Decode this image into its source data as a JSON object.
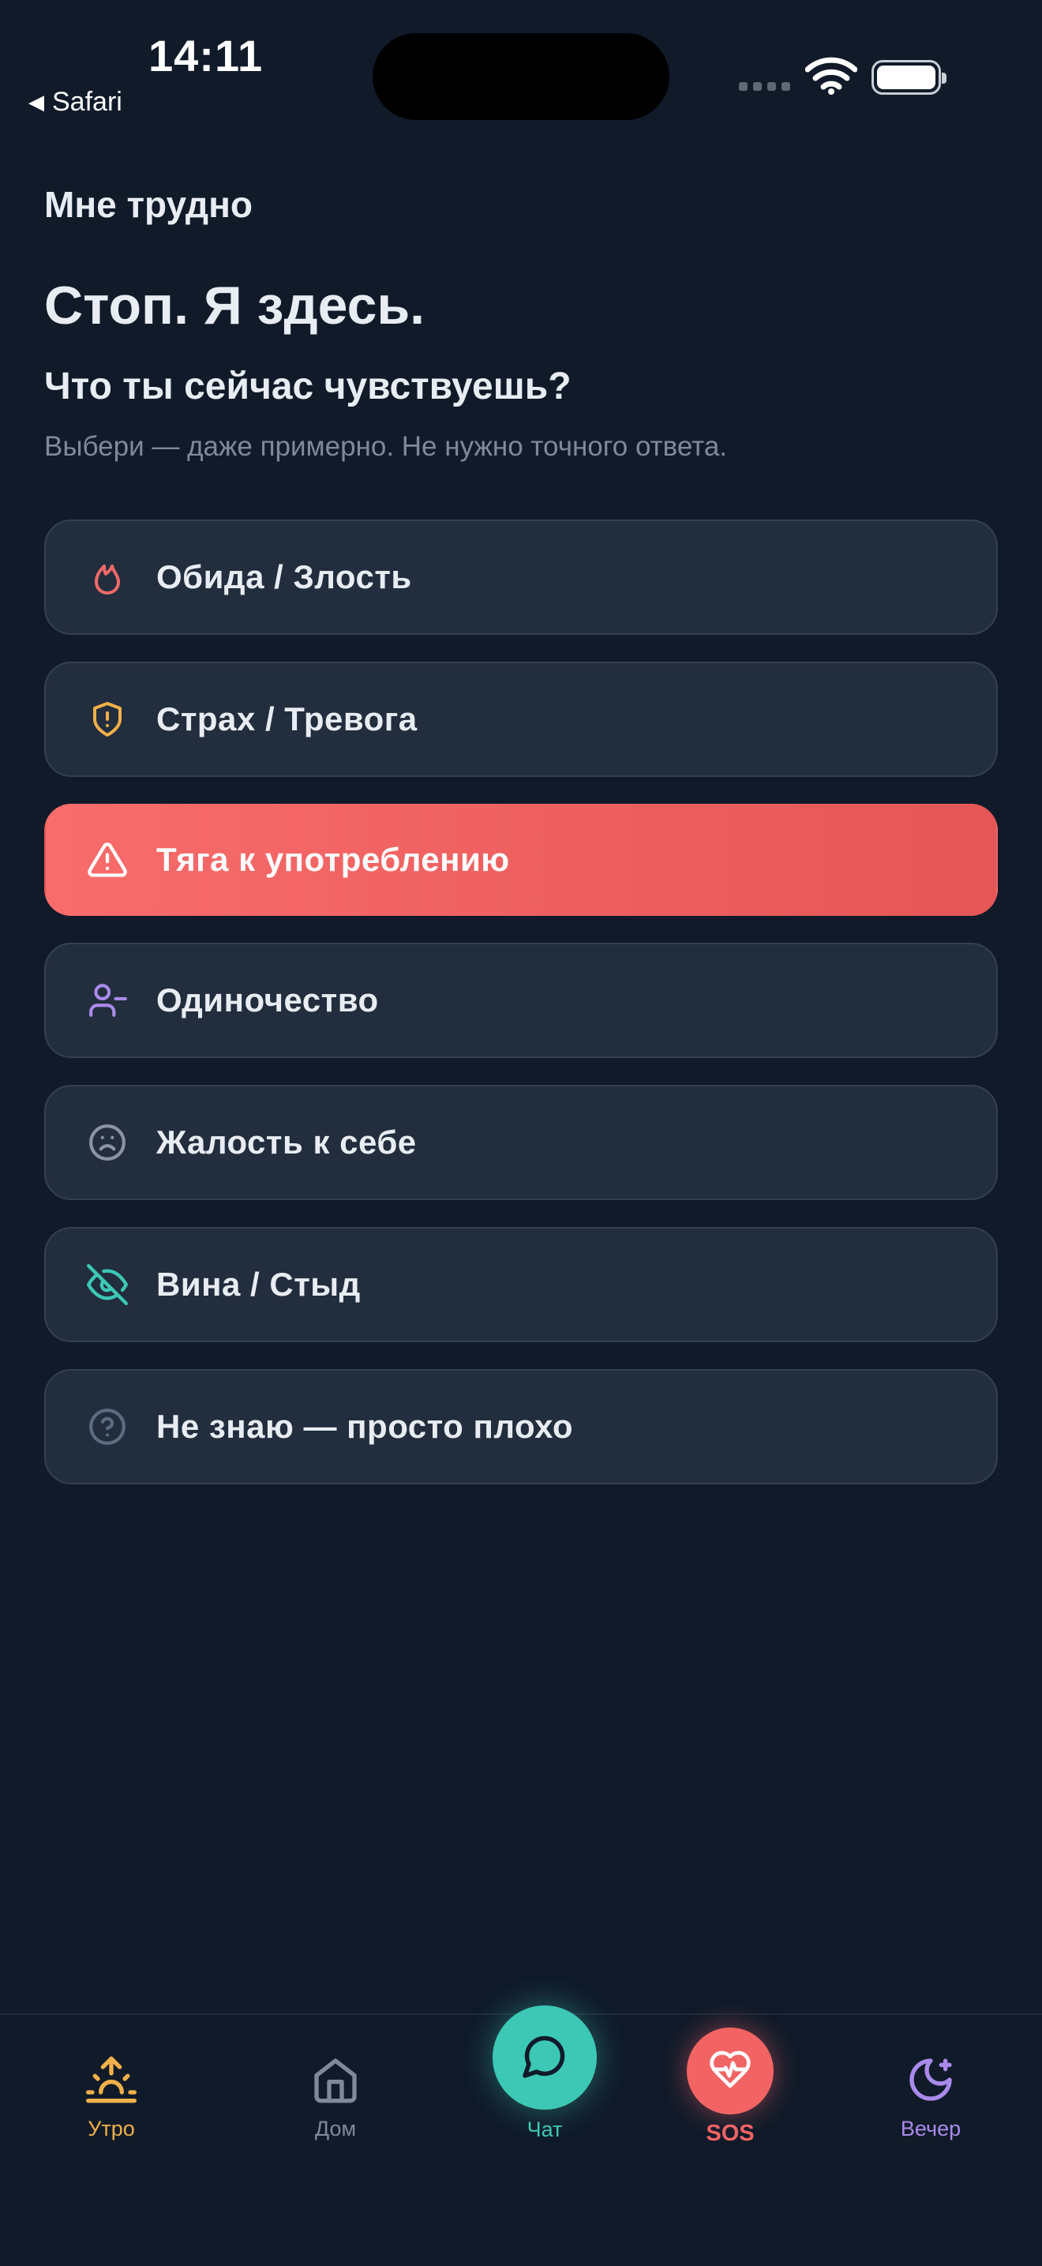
{
  "status_bar": {
    "time": "14:11",
    "back_app": "Safari"
  },
  "header": {
    "section": "Мне трудно",
    "title": "Стоп. Я здесь.",
    "question": "Что ты сейчас чувствуешь?",
    "hint": "Выбери — даже примерно. Не нужно точного ответа."
  },
  "options": [
    {
      "label": "Обида / Злость",
      "icon": "flame-icon",
      "color": "#f26a6a"
    },
    {
      "label": "Страх / Тревога",
      "icon": "shield-alert-icon",
      "color": "#f2b04a"
    },
    {
      "label": "Тяга к употреблению",
      "icon": "warning-triangle-icon",
      "color": "#ffffff",
      "selected": true
    },
    {
      "label": "Одиночество",
      "icon": "user-minus-icon",
      "color": "#a98bea"
    },
    {
      "label": "Жалость к себе",
      "icon": "frown-icon",
      "color": "#8a94a6"
    },
    {
      "label": "Вина / Стыд",
      "icon": "eye-off-icon",
      "color": "#3cc8b4"
    },
    {
      "label": "Не знаю — просто плохо",
      "icon": "help-circle-icon",
      "color": "#5d6a80"
    }
  ],
  "tabs": {
    "morning": {
      "label": "Утро",
      "color": "#f2b04a",
      "icon": "sunrise-icon"
    },
    "home": {
      "label": "Дом",
      "color": "#7e8a9b",
      "icon": "home-icon"
    },
    "chat": {
      "label": "Чат",
      "color": "#3cc8b4",
      "icon": "chat-bubble-icon"
    },
    "sos": {
      "label": "SOS",
      "color": "#f26464",
      "icon": "heart-pulse-icon"
    },
    "evening": {
      "label": "Вечер",
      "color": "#a98bea",
      "icon": "moon-star-icon"
    }
  }
}
